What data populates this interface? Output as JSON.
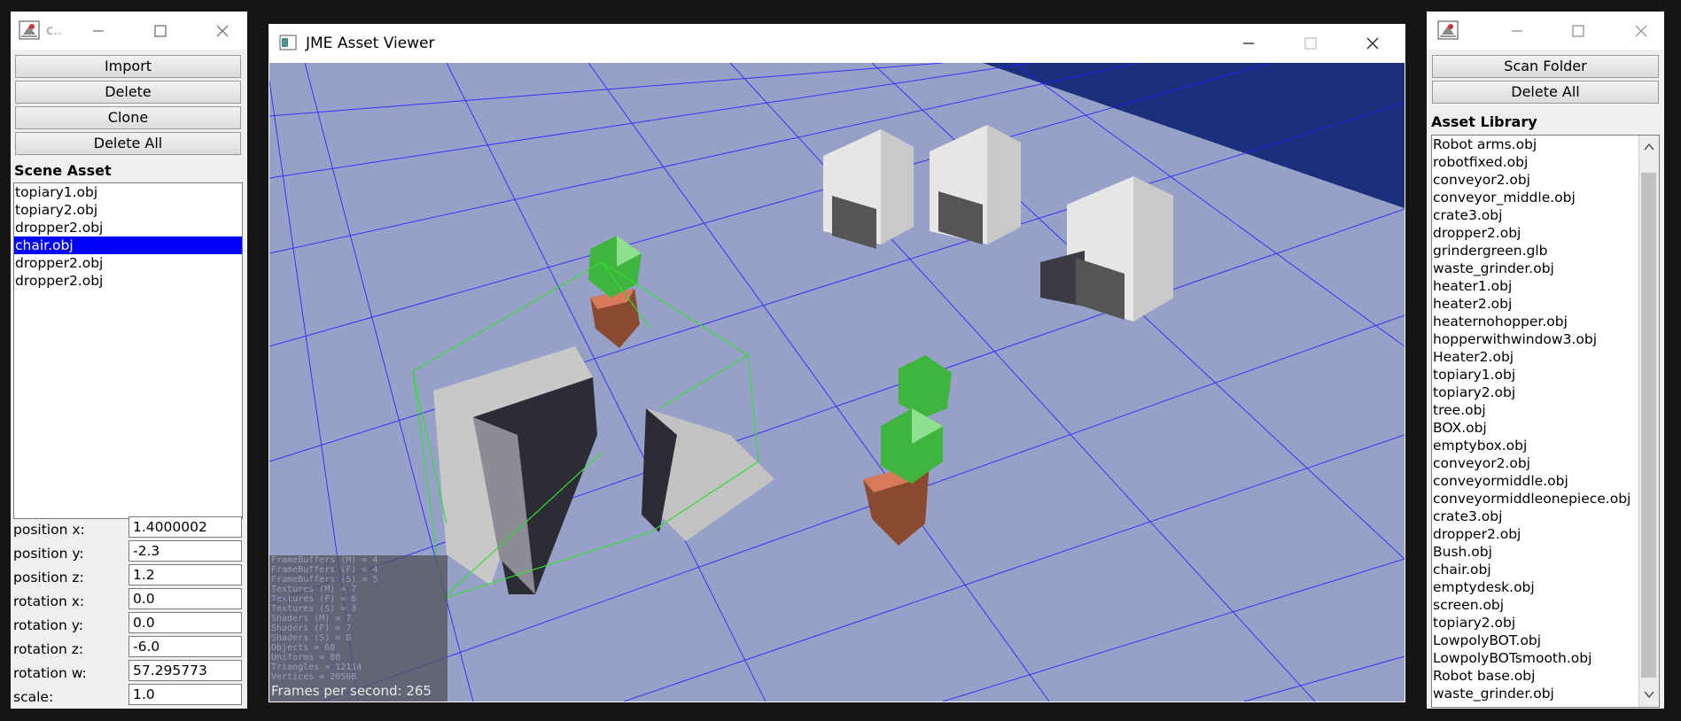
{
  "colors": {
    "selection": "#0000ff",
    "floor": "#97a1c8",
    "grid": "#2222ff",
    "sky": "#1c2f7a"
  },
  "left_window": {
    "title": "c..",
    "buttons": {
      "import": "Import",
      "delete": "Delete",
      "clone": "Clone",
      "delete_all": "Delete All"
    },
    "scene_label": "Scene Asset",
    "scene_items": [
      "topiary1.obj",
      "topiary2.obj",
      "dropper2.obj",
      "chair.obj",
      "dropper2.obj",
      "dropper2.obj"
    ],
    "selected_index": 3,
    "props": [
      {
        "label": "position x:",
        "value": "1.4000002"
      },
      {
        "label": "position y:",
        "value": "-2.3"
      },
      {
        "label": "position z:",
        "value": "1.2"
      },
      {
        "label": "rotation x:",
        "value": "0.0"
      },
      {
        "label": "rotation y:",
        "value": "0.0"
      },
      {
        "label": "rotation z:",
        "value": "-6.0"
      },
      {
        "label": "rotation w:",
        "value": "57.295773"
      },
      {
        "label": "scale:",
        "value": "1.0"
      }
    ]
  },
  "viewer_window": {
    "title": "JME Asset Viewer",
    "stats": [
      "FrameBuffers (M) = 4",
      "FrameBuffers (F) = 4",
      "FrameBuffers (S) = 5",
      "Textures (M) = 7",
      "Textures (F) = 6",
      "Textures (S) = 3",
      "Shaders (M) = 7",
      "Shaders (F) = 7",
      "Shaders (S) = 8",
      "Objects = 68",
      "Uniforms = 88",
      "Triangles = 12114",
      "Vertices = 20508"
    ],
    "fps": "Frames per second: 265"
  },
  "right_window": {
    "buttons": {
      "scan_folder": "Scan Folder",
      "delete_all": "Delete All"
    },
    "library_label": "Asset Library",
    "library_items": [
      "Robot arms.obj",
      "robotfixed.obj",
      "conveyor2.obj",
      "conveyor_middle.obj",
      "crate3.obj",
      "dropper2.obj",
      "grindergreen.glb",
      "waste_grinder.obj",
      "heater1.obj",
      "heater2.obj",
      "heaternohopper.obj",
      "hopperwithwindow3.obj",
      "Heater2.obj",
      "topiary1.obj",
      "topiary2.obj",
      "tree.obj",
      "BOX.obj",
      "emptybox.obj",
      "conveyor2.obj",
      "conveyormiddle.obj",
      "conveyormiddleonepiece.obj",
      "crate3.obj",
      "dropper2.obj",
      "Bush.obj",
      "chair.obj",
      "emptydesk.obj",
      "screen.obj",
      "topiary2.obj",
      "LowpolyBOT.obj",
      "LowpolyBOTsmooth.obj",
      "Robot base.obj",
      "waste_grinder.obj"
    ]
  }
}
